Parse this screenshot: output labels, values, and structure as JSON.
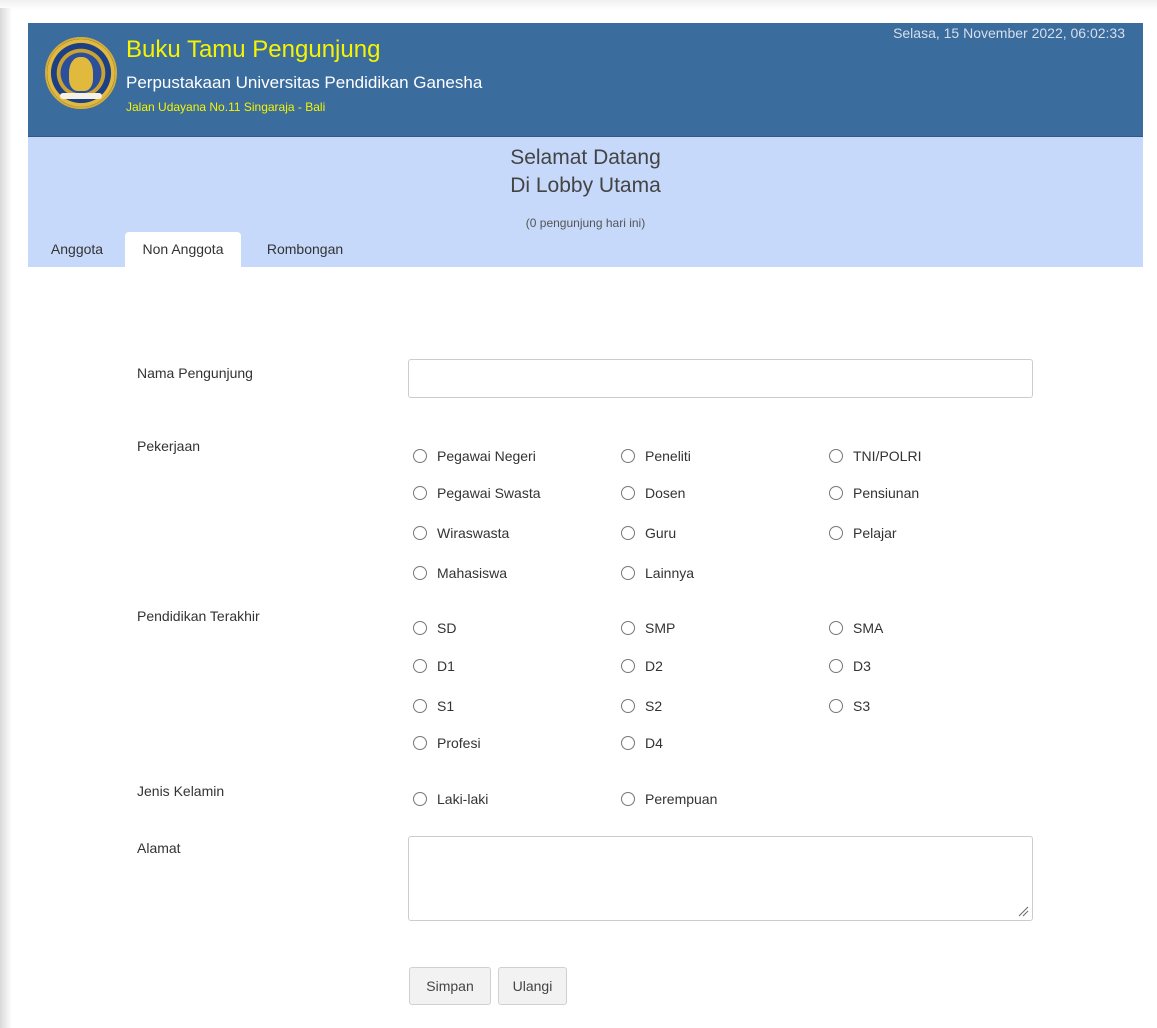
{
  "header": {
    "title": "Buku Tamu Pengunjung",
    "subtitle": "Perpustakaan Universitas Pendidikan Ganesha",
    "address": "Jalan Udayana No.11 Singaraja - Bali",
    "datetime": "Selasa, 15 November 2022, 06:02:33",
    "colors": {
      "bar": "#3a6c9e",
      "title": "#f6f400"
    }
  },
  "welcome": {
    "line1": "Selamat Datang",
    "line2": "Di Lobby Utama",
    "visitor_count": "(0 pengunjung hari ini)",
    "background": "#c6d9fa"
  },
  "tabs": [
    {
      "label": "Anggota",
      "active": false
    },
    {
      "label": "Non Anggota",
      "active": true
    },
    {
      "label": "Rombongan",
      "active": false
    }
  ],
  "form": {
    "name_label": "Nama Pengunjung",
    "name_value": "",
    "pekerjaan_label": "Pekerjaan",
    "pekerjaan_options": [
      "Pegawai Negeri",
      "Peneliti",
      "TNI/POLRI",
      "Pegawai Swasta",
      "Dosen",
      "Pensiunan",
      "Wiraswasta",
      "Guru",
      "Pelajar",
      "Mahasiswa",
      "Lainnya"
    ],
    "pendidikan_label": "Pendidikan Terakhir",
    "pendidikan_options": [
      "SD",
      "SMP",
      "SMA",
      "D1",
      "D2",
      "D3",
      "S1",
      "S2",
      "S3",
      "Profesi",
      "D4"
    ],
    "gender_label": "Jenis Kelamin",
    "gender_options": [
      "Laki-laki",
      "Perempuan"
    ],
    "alamat_label": "Alamat",
    "alamat_value": "",
    "save_button": "Simpan",
    "reset_button": "Ulangi"
  }
}
